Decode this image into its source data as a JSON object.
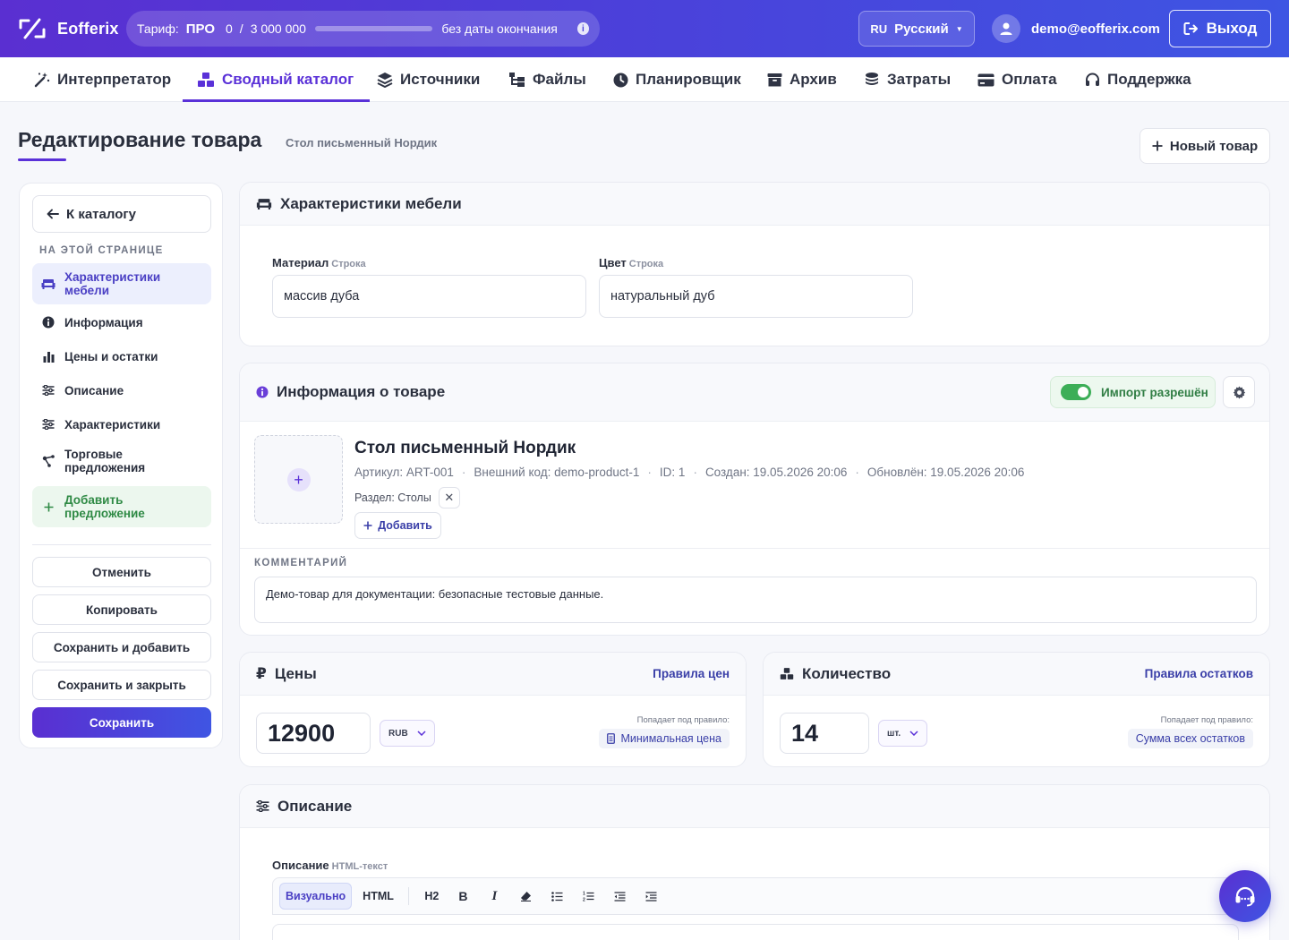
{
  "app": {
    "name": "Eofferix",
    "tariff_label": "Тариф:",
    "plan": "ПРО",
    "usage_used": "0",
    "usage_sep": "/",
    "usage_limit": "3 000 000",
    "usage_fraction": 0,
    "expiry": "без даты окончания",
    "lang_code": "RU",
    "lang_name": "Русский",
    "user_email": "demo@eofferix.com",
    "logout_label": "Выход"
  },
  "nav": {
    "items": [
      {
        "label": "Интерпретатор",
        "icon": "magic-wand-icon"
      },
      {
        "label": "Сводный каталог",
        "icon": "boxes-icon",
        "active": true
      },
      {
        "label": "Источники",
        "icon": "layers-icon"
      },
      {
        "label": "Файлы",
        "icon": "folder-tree-icon"
      },
      {
        "label": "Планировщик",
        "icon": "clock-icon"
      },
      {
        "label": "Архив",
        "icon": "archive-icon"
      },
      {
        "label": "Затраты",
        "icon": "coins-icon"
      },
      {
        "label": "Оплата",
        "icon": "credit-card-icon"
      },
      {
        "label": "Поддержка",
        "icon": "headset-icon"
      }
    ]
  },
  "page": {
    "title": "Редактирование товара",
    "subtitle": "Стол письменный Нордик",
    "new_product_label": "Новый товар"
  },
  "sidebar": {
    "back_label": "К каталогу",
    "heading": "НА ЭТОЙ СТРАНИЦЕ",
    "items": [
      {
        "label": "Характеристики мебели",
        "icon": "sofa-icon"
      },
      {
        "label": "Информация",
        "icon": "info-icon"
      },
      {
        "label": "Цены и остатки",
        "icon": "bar-chart-icon"
      },
      {
        "label": "Описание",
        "icon": "sliders-icon"
      },
      {
        "label": "Характеристики",
        "icon": "sliders-icon"
      },
      {
        "label": "Торговые предложения",
        "icon": "share-nodes-icon"
      },
      {
        "label": "Добавить предложение",
        "icon": "plus-icon"
      }
    ],
    "buttons": {
      "cancel": "Отменить",
      "copy": "Копировать",
      "save_add": "Сохранить и добавить",
      "save_close": "Сохранить и закрыть",
      "save": "Сохранить"
    }
  },
  "furniture": {
    "title": "Характеристики мебели",
    "fields": [
      {
        "label": "Материал",
        "type": "Строка",
        "value": "массив дуба"
      },
      {
        "label": "Цвет",
        "type": "Строка",
        "value": "натуральный дуб"
      }
    ]
  },
  "info": {
    "title": "Информация о товаре",
    "import_label": "Импорт разрешён",
    "import_enabled": true,
    "product_name": "Стол письменный Нордик",
    "article": "Артикул: ART-001",
    "external_code": "Внешний код: demo-product-1",
    "id": "ID: 1",
    "created": "Создан: 19.05.2026 20:06",
    "updated": "Обновлён: 19.05.2026 20:06",
    "section": "Раздел: Столы",
    "add_label": "Добавить",
    "comment_label": "КОММЕНТАРИЙ",
    "comment": "Демо-товар для документации: безопасные тестовые данные."
  },
  "prices": {
    "title": "Цены",
    "rules_link": "Правила цен",
    "value": "12900",
    "currency": "RUB",
    "rule_caption": "Попадает под правило:",
    "rule_name": "Минимальная цена"
  },
  "quantity": {
    "title": "Количество",
    "rules_link": "Правила остатков",
    "value": "14",
    "unit": "шт.",
    "rule_caption": "Попадает под правило:",
    "rule_name": "Сумма всех остатков"
  },
  "description": {
    "title": "Описание",
    "field_label": "Описание",
    "field_type": "HTML-текст",
    "toolbar": {
      "visual": "Визуально",
      "html": "HTML",
      "h2": "H2"
    }
  }
}
